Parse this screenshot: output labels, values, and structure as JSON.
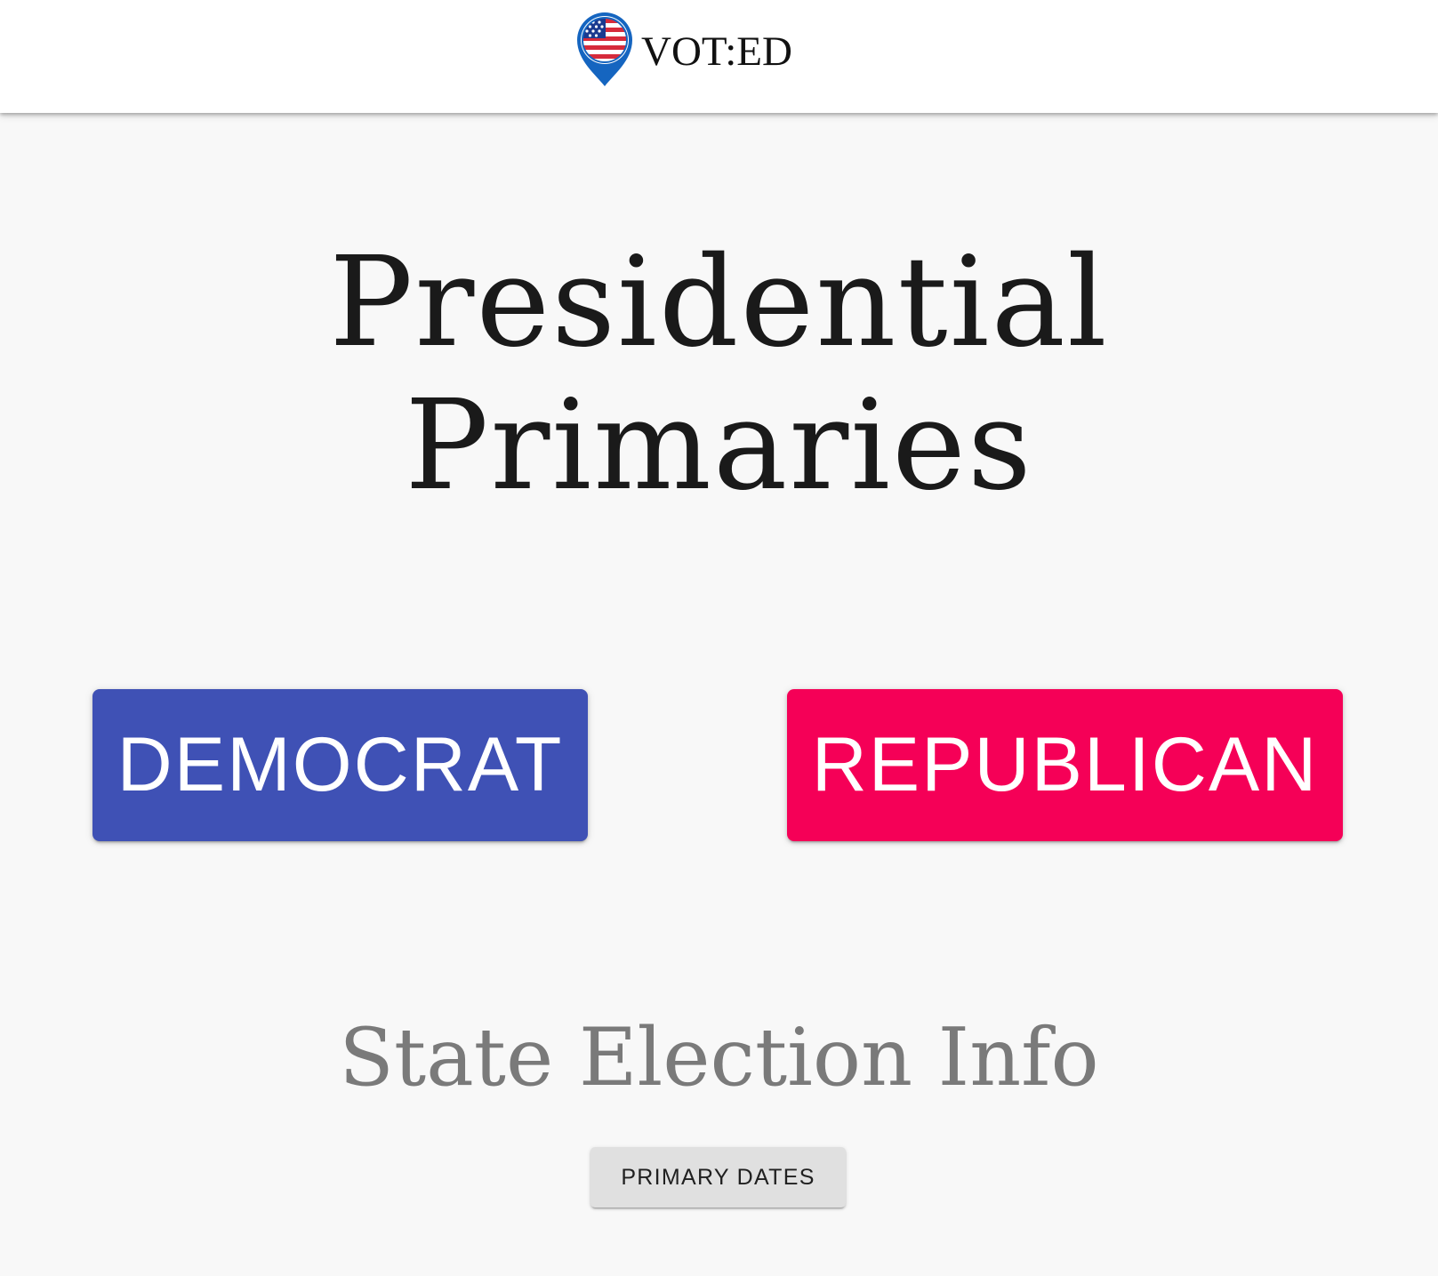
{
  "header": {
    "brand_name": "VOT:ED",
    "logo_icon": "us-flag-map-pin-icon"
  },
  "main": {
    "title": "Presidential Primaries",
    "parties": {
      "democrat_label": "DEMOCRAT",
      "republican_label": "REPUBLICAN"
    },
    "state_section": {
      "title": "State Election Info",
      "primary_dates_label": "PRIMARY DATES"
    }
  },
  "colors": {
    "democrat": "#3f51b5",
    "republican": "#f50057",
    "logo_blue": "#1565c0",
    "flag_red": "#d62b3b",
    "neutral_button": "#e0e0e0"
  }
}
